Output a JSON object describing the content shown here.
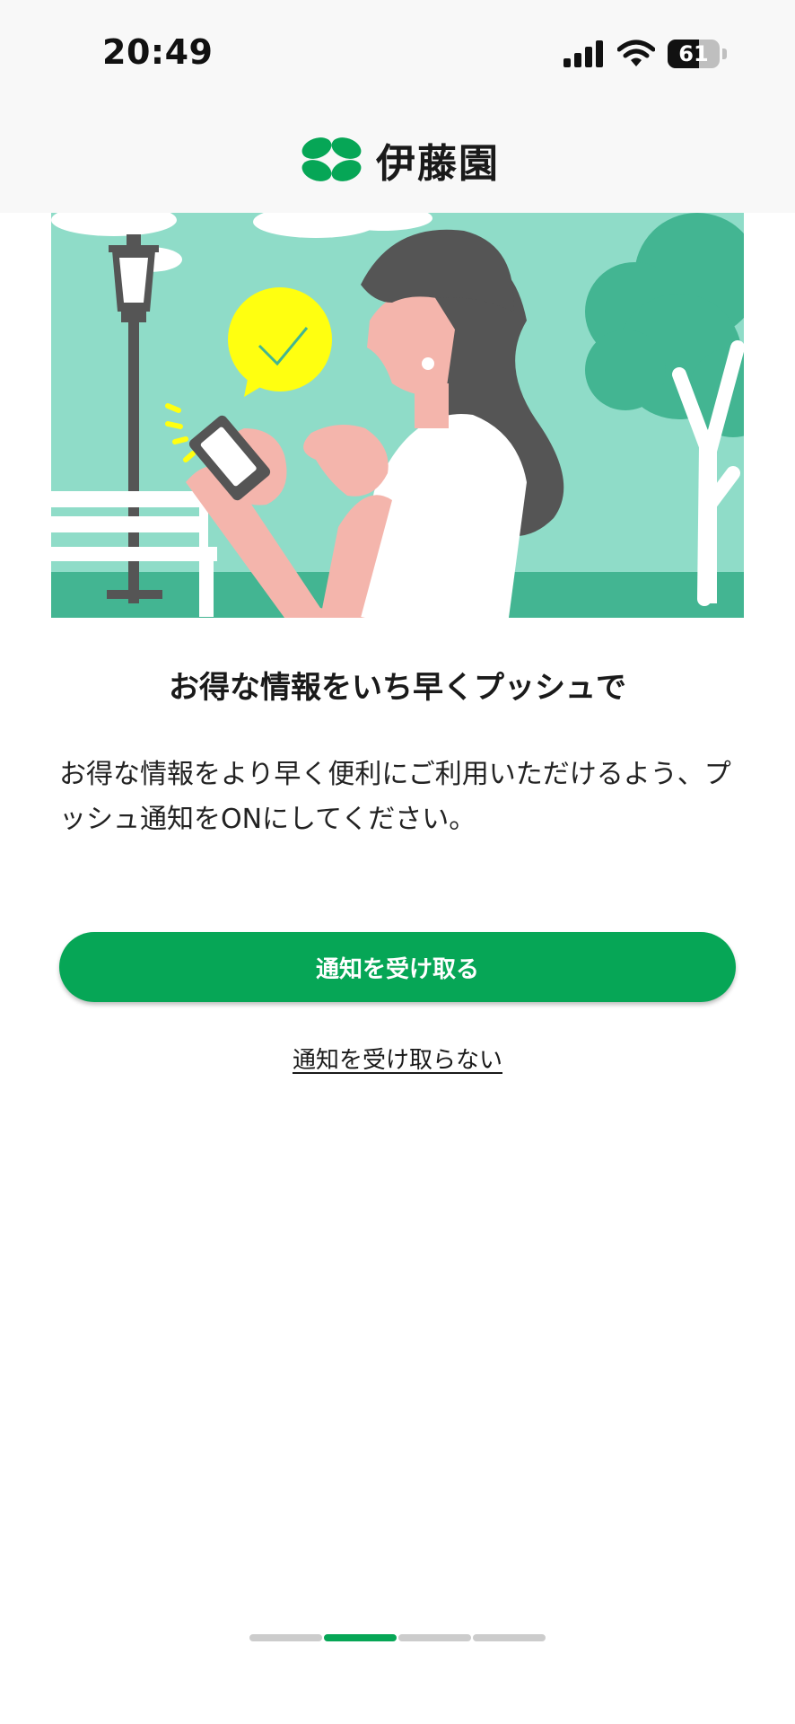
{
  "status_bar": {
    "time": "20:49",
    "battery": "61",
    "battery_level": 0.61
  },
  "header": {
    "brand_name": "伊藤園",
    "logo_icon": "clover-leaf-icon"
  },
  "colors": {
    "brand_green": "#06a656",
    "hero_background": "#8fdcc8",
    "tree_green": "#43b592"
  },
  "content": {
    "headline": "お得な情報をいち早くプッシュで",
    "body": "お得な情報をより早く便利にご利用いただけるよう、プッシュ通知をONにしてください。",
    "accept_label": "通知を受け取る",
    "decline_label": "通知を受け取らない"
  },
  "pager": {
    "total": 4,
    "active_index": 1
  }
}
